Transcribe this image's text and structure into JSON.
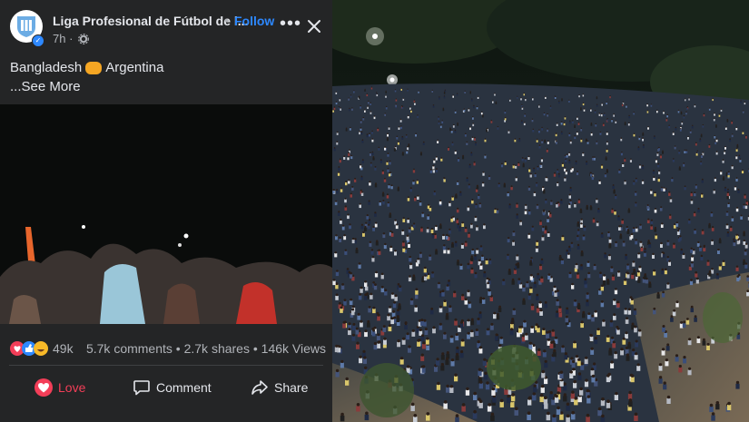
{
  "post": {
    "page_name": "Liga Profesional de Fútbol de l...",
    "dot": "•",
    "follow_label": "Follow",
    "time": "7h ·",
    "caption_left": "Bangladesh",
    "caption_right": "Argentina",
    "see_more": "...See More"
  },
  "stats": {
    "reactions": "49k",
    "comments": "5.7k comments",
    "shares": "2.7k shares",
    "views": "146k Views",
    "separator": " • "
  },
  "actions": {
    "love_label": "Love",
    "comment_label": "Comment",
    "share_label": "Share"
  },
  "colors": {
    "card_bg": "#242526",
    "accent_blue": "#2d88ff",
    "love_red": "#f33e58",
    "text": "#e4e6eb",
    "muted": "#b0b3b8"
  },
  "icons": [
    "league-logo-icon",
    "verified-icon",
    "globe-gear-icon",
    "more-icon",
    "close-icon",
    "handshake-icon",
    "like-reaction-icon",
    "love-reaction-icon",
    "haha-reaction-icon",
    "love-icon",
    "comment-icon",
    "share-icon"
  ]
}
